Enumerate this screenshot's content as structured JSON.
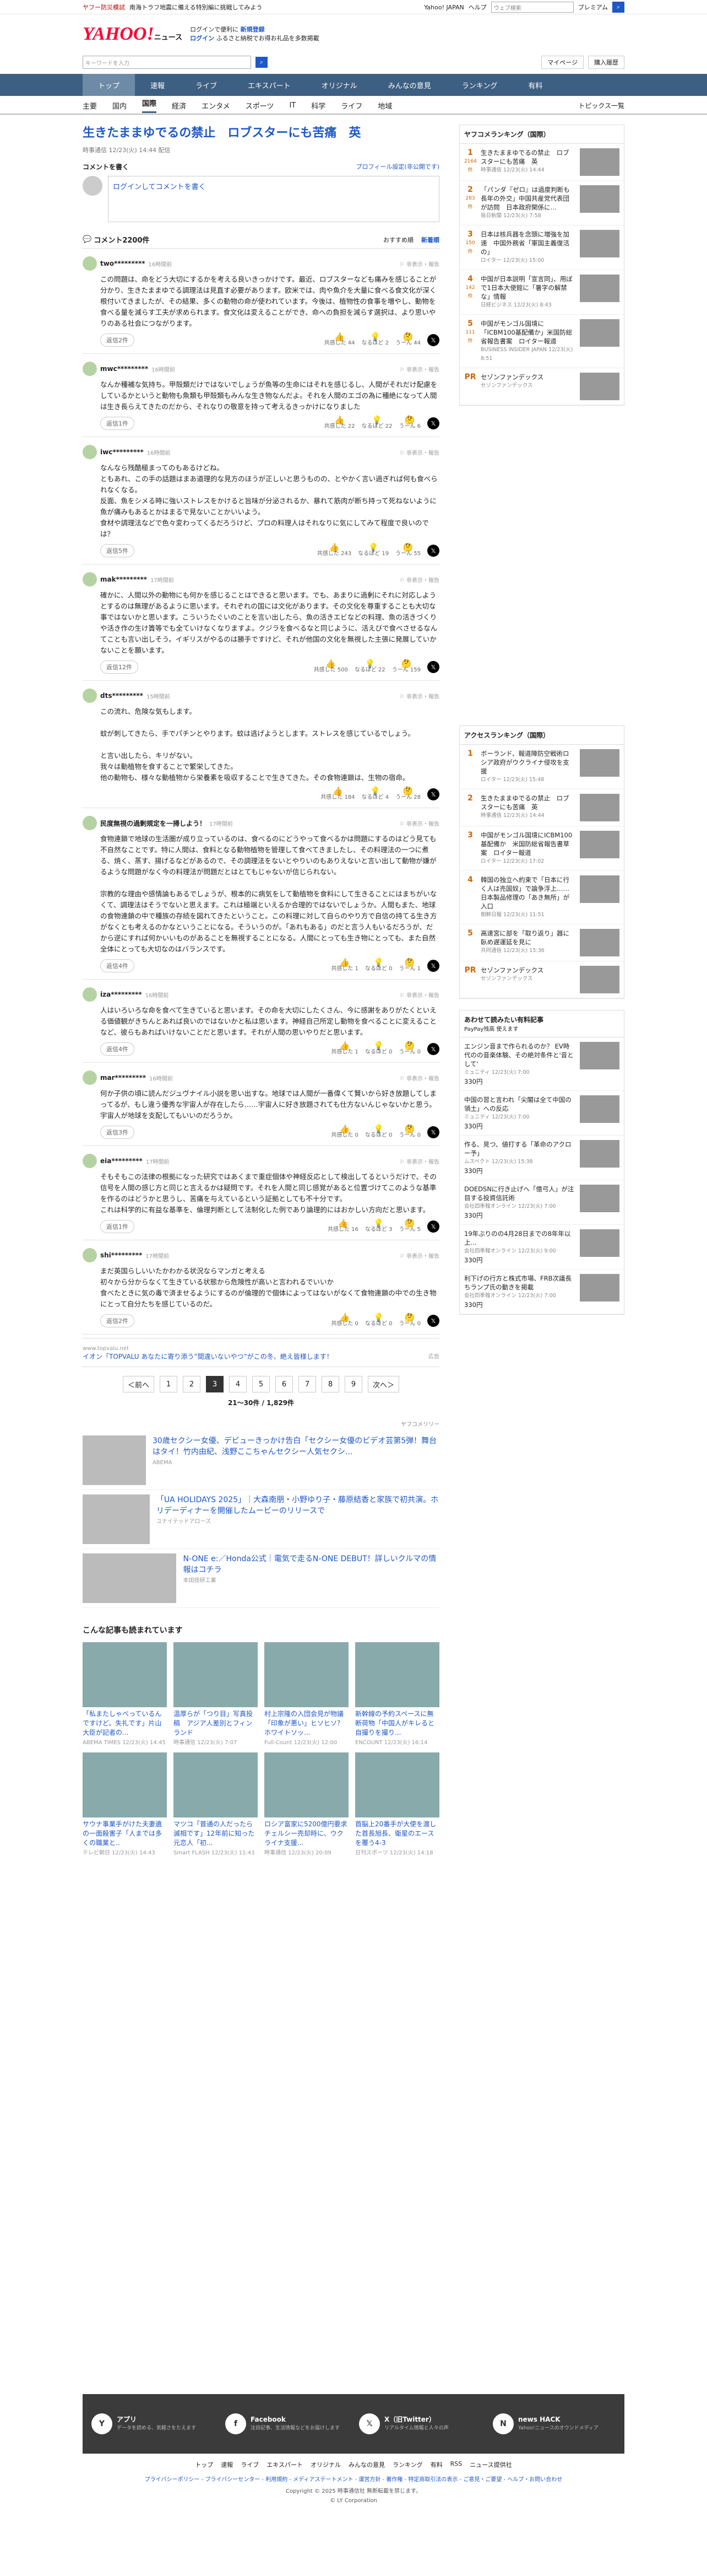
{
  "topbar": {
    "left1": "ヤフー防災模試",
    "left2": "南海トラフ地震に備える特別編に挑戦してみよう",
    "right1": "Yahoo! JAPAN",
    "right2": "ヘルプ",
    "search_placeholder": "ウェブ検索",
    "premium": "プレミアム"
  },
  "header": {
    "logo": "YAHOO!",
    "logo_sub": "ニュース",
    "promo1": "ログインで便利に",
    "promo1b": "新規登録",
    "promo2": "ログイン",
    "promo2b": "ふるさと納税でお得お礼品を多数掲載",
    "link1": "",
    "link2": ""
  },
  "search": {
    "placeholder": "キーワードを入力",
    "mypage": "マイページ",
    "login": "購入履歴"
  },
  "nav": [
    "トップ",
    "速報",
    "ライブ",
    "エキスパート",
    "オリジナル",
    "みんなの意見",
    "ランキング",
    "有料"
  ],
  "subnav": [
    "主要",
    "国内",
    "国際",
    "経済",
    "エンタメ",
    "スポーツ",
    "IT",
    "科学",
    "ライフ",
    "地域"
  ],
  "subnav_right": "トピックス一覧",
  "article": {
    "title": "生きたままゆでるの禁止　ロブスターにも苦痛　英",
    "meta": "時事通信 12/23(火) 14:44 配信"
  },
  "comment_post": {
    "heading": "コメントを書く",
    "profile": "プロフィール設定(非公開です)",
    "login": "ログイン",
    "text": "してコメントを書く"
  },
  "comments_head": {
    "count": "コメント2200件",
    "sort1": "おすすめ順",
    "sort2": "新着順"
  },
  "comments": [
    {
      "name": "two*********",
      "time": "16時間前",
      "text": "この問題は、命をどう大切にするかを考える良いきっかけです。最近、ロブスターなども痛みを感じることが分かり、生きたままゆでる調理法は見直す必要があります。欧米では、肉や魚介を大量に食べる食文化が深く根付いてきましたが、その結果、多くの動物の命が使われています。今後は、植物性の食事を増やし、動物を食べる量を減らす工夫が求められます。食文化は変えることができ、命への負担を減らす選択は、より思いやりのある社会につながります。",
      "reply": "返信2件",
      "v1": "共感した 44",
      "v2": "なるほど 2",
      "v3": "うーん 44"
    },
    {
      "name": "mwc*********",
      "time": "16時間前",
      "text": "なんか種補な気持ち。甲殻類だけではないでしょうが魚等の生命にはそれを感じるし、人間がそれだけ配慮をしているかというと動物も魚類も甲殻類もみんな生き物なんだよ。それを人間のエゴの為に種絶になって人間は生き長らえてきたのだから、それなりの敬意を持って考えるきっかけになりました",
      "reply": "返信1件",
      "v1": "共感した 22",
      "v2": "なるほど 22",
      "v3": "うーん 6"
    },
    {
      "name": "iwc*********",
      "time": "16時間前",
      "text": "なんなら残酷極まってのもあるけどね。\nともあれ、この手の話題はまあ道理的な見方のほうが正しいと思うものの、とやかく言い過ぎれば何も食べられなくなる。\n反面、魚をシメる時に強いストレスをかけると旨味が分泌されるか、暴れて筋肉が断ち持って死ねないように魚が痛みもあるとかはまるで見ないことかいいよう。\n食材や調理法などで色々変わってくるだろうけど、プロの料理人はそれなりに気にしてみて程度で良いのでは？",
      "reply": "返信5件",
      "v1": "共感した 243",
      "v2": "なるほど 19",
      "v3": "うーん 55"
    },
    {
      "name": "mak*********",
      "time": "17時間前",
      "text": "確かに、人間以外の動物にも何かを感じることはできると思います。でも、あまりに過剰にそれに対応しようとするのは無理があるように思います。それぞれの国には文化があります。その文化を尊重することも大切な事ではないかと思います。こういうたぐいのことを言い出したら、魚の活きエビなどの料理、魚の活きづくりや活き作の生け簀等でも全ていけなくなりますよ。クジラを食べるなと同じように、活えびで食べさせるなんてことも言い出しそう。イギリスがやるのは勝手ですけど、それが他国の文化を無視した主張に発展していかないことを願います。",
      "reply": "返信12件",
      "v1": "共感した 500",
      "v2": "なるほど 22",
      "v3": "うーん 159"
    },
    {
      "name": "dts*********",
      "time": "15時間前",
      "text": "この流れ、危険な気もします。\n\n蚊が刺してきたら、手でパチンとやります。蚊は逃げようとします。ストレスを感じているでしょう。\n\nと言い出したら、キリがない。\n我々は動植物を食することで繁栄してきた。\n他の動物も、様々な動植物から栄養素を吸収することで生きてきた。その食物連鎖は、生物の宿命。",
      "reply": "",
      "v1": "共感した 184",
      "v2": "なるほど 4",
      "v3": "うーん 28"
    },
    {
      "name": "民度無視の過剰規定を一掃しよう！",
      "time": "17時間前",
      "text": "食物連鎖で地球の生活圏が成り立っているのは、食べるのにどうやって食べるかは問題にするのはどう見ても不自然なことです。特に人間は、食料となる動物植物を管理して食べてきましたし、その料理法の一つに煮る、焼く、蒸す、揚げるなどがあるので、その調理法をないとやりいのもありえないと言い出して動物が嫌がるような問題がなく今の料理法が問題だとはとてもじゃないが信じられない。\n\n宗教的な理由や感情論もあるでしょうが、根本的に病気をして動植物を食料にして生きることにはまちがいなくて、調理法はそうでないと思えます。これは極端といえるか合理的ではないでしょうか。人間もまた、地球の食物連鎖の中で種族の存続を図れてきたということ。この料理に対して自らのやり方で自信の持てる生き方がなくとも考えるのかなということになる。そういうのが。「あれもある」のだと言う人もいるだろうが、だから逆にすれば何かいいものがあることを無視することになる。人間にとっても生き物にとっても、また自然全体にとっても大切なのはバランスです。",
      "reply": "返信4件",
      "v1": "共感した 1",
      "v2": "なるほど 0",
      "v3": "うーん 1"
    },
    {
      "name": "iza*********",
      "time": "16時間前",
      "text": "人はいろいろな命を食べて生きていると思います。その命を大切にしたくさん、今に感謝をありがたくといえる価値観がきちんとあれば良いのではないかと私は思います。神経自己所定し動物を食べることに変えることなど、彼らもあればいけないことだと思います。それが人間の思いやりだと思います。",
      "reply": "返信4件",
      "v1": "共感した 1",
      "v2": "なるほど 0",
      "v3": "うーん 0"
    },
    {
      "name": "mar*********",
      "time": "16時間前",
      "text": "何か子供の頃に読んだジュヴナイル小説を思い出すな。地球では人間が一番偉くて賢いから好き放題してしまってるが、もし違う優秀な宇宙人が存在したら……宇宙人に好き放題されても仕方ないんじゃないかと思う。宇宙人が地球を支配してもいいのだろうか。",
      "reply": "返信3件",
      "v1": "共感した 0",
      "v2": "なるほど 0",
      "v3": "うーん 0"
    },
    {
      "name": "eia*********",
      "time": "17時間前",
      "text": "そもそもこの法律の根拠になった研究ではあくまで重症個体や神経反応として検出してるというだけで、その信号を人間の感じ方と同じと言えるかは疑問です。それを人間と同じ感覚があると位置づけてこのような基準を作るのはどうかと思うし、苦痛を与えているという証拠としても不十分です。\nこれは科学的に有益な基準を、倫理判断として法制化した例であり論理的にはおかしい方向だと思います。",
      "reply": "返信1件",
      "v1": "共感した 16",
      "v2": "なるほど 3",
      "v3": "うーん 5"
    },
    {
      "name": "shi*********",
      "time": "17時間前",
      "text": "まだ英国らしいいたかわかる状況ならマンガと考える\n初々から分からなくて生きている状態から危険性が高いと言われるでいいか\n食べたときに気の毒で済ませるようにするのが倫理的で個体によってはないがなくて食物連鎖の中での生き物にとって自分たちを感じているのだ。",
      "reply": "返信2件",
      "v1": "共感した 0",
      "v2": "なるほど 0",
      "v3": "うーん 0"
    }
  ],
  "ad": {
    "src": "www.topvalu.net",
    "text": "イオン「TOPVALU あなたに寄り添う”間違いないやつ”がこの冬、絶え皆様します！",
    "tag": "広告"
  },
  "pager": {
    "prev": "＜前へ",
    "pages": [
      "1",
      "2",
      "3",
      "4",
      "5",
      "6",
      "7",
      "8",
      "9"
    ],
    "current": "3",
    "next": "次へ＞",
    "count": "21〜30件 / 1,829件"
  },
  "sponsor": "ヤフコメリリー",
  "adcards": [
    {
      "text": "30歳セクシー女優、デビューきっかけ告白「セクシー女優のビデオ芸第5弾！舞台はタイ！竹内由紀、浅野ここちゃんセクシー人気セクシ...",
      "src": "ABEMA"
    },
    {
      "text": "「UA HOLIDAYS 2025」｜大森南朋・小野ゆり子・藤原結香と家族で初共演。ホリデーディナーを開催したムービーのリリースで",
      "src": "ユナイテッドアローズ"
    },
    {
      "text": "N-ONE e:／Honda公式｜電気で走るN-ONE DEBUT！詳しいクルマの情報はコチラ",
      "src": "本田技研工業"
    }
  ],
  "related": {
    "title": "こんな記事も読まれています",
    "items": [
      {
        "text": "「私またしゃべっているんですけど。失礼です」片山大臣が記者の...",
        "src": "ABEMA TIMES 12/23(火) 14:45"
      },
      {
        "text": "温厚らが「つり目」写真投稿　アジア人差別とフィンランド",
        "src": "時事通信 12/23(火) 7:07"
      },
      {
        "text": "村上宗隆の入団会見が物議「印象が悪い」ヒソヒソ？ホワイトソッ...",
        "src": "Full-Count 12/23(火) 12:00"
      },
      {
        "text": "新幹線の予約スペースに無断荷物「中国人がキレると自撮りを撮り...",
        "src": "ENCOUNT 12/23(火) 16:14"
      },
      {
        "text": "サウナ事業手がけた夫妻遺の一面殺害子「人までは多くの職業と..",
        "src": "テレビ朝日 12/23(火) 14:43"
      },
      {
        "text": "マツコ「普通の人だったら滅相です」12年前に知った元恋人「初...",
        "src": "Smart FLASH 12/23(火) 11:43"
      },
      {
        "text": "ロシア富家に5200億円要求　チェルシー売却時に、ウクライナ支援...",
        "src": "時事通信 12/23(火) 20:09"
      },
      {
        "text": "首脳上20番手が大使を渡した首長旭長、衛星のエースを覆う4-3",
        "src": "日刊スポーツ 12/23(火) 14:18"
      }
    ]
  },
  "ranking_social": {
    "title": "ヤフコメランキング（国際）",
    "items": [
      {
        "n": "1",
        "c": "2164件",
        "text": "生きたままゆでるの禁止　ロブスターにも苦痛　英",
        "src": "時事通信 12/23(火) 14:44"
      },
      {
        "n": "2",
        "c": "283件",
        "text": "「パンダ『ゼロ』は過度判断も長年の外交」中国共産党代表団が訪問　日本政府関係に…",
        "src": "毎日新聞 12/23(火) 7:58"
      },
      {
        "n": "3",
        "c": "150件",
        "text": "日本は核兵器を念頭に増強を加速　中国外務省「軍国主義復活の」",
        "src": "ロイター 12/23(火) 15:00"
      },
      {
        "n": "4",
        "c": "142件",
        "text": "中国が日本説明「宣言同」、用ぼで1日本大使館に「暑字の解禁な」情報",
        "src": "日経ビジネス 12/23(火) 8:43"
      },
      {
        "n": "5",
        "c": "111件",
        "text": "中国がモンゴル国境に「ICBM100基配備か」米国防総省報告書案　ロイター報道",
        "src": "BUSINESS INSIDER JAPAN 12/23(火) 8:51"
      },
      {
        "n": "PR",
        "c": "",
        "text": "セゾンファンデックス",
        "src": "セゾンファンデックス"
      }
    ]
  },
  "ranking_access": {
    "title": "アクセスランキング（国際）",
    "items": [
      {
        "n": "1",
        "text": "ボーランド、報道陣防空戦術ロシア政府がウクライナ侵攻を支援",
        "src": "ロイター 12/23(火) 15:48"
      },
      {
        "n": "2",
        "text": "生きたままゆでるの禁止　ロブスターにも苦痛　英",
        "src": "時事通信 12/23(火) 14:44"
      },
      {
        "n": "3",
        "text": "中国がモンゴル国境にICBM100基配備か　米国防総省報告書草案　ロイター報道",
        "src": "ロイター 12/23(火) 17:02"
      },
      {
        "n": "4",
        "text": "韓国の独立へ約束で「日本に行く人は売国奴」で論争浮上……日本製品修理の「あき無所」が入口",
        "src": "朝鮮日報 12/23(火) 11:51"
      },
      {
        "n": "5",
        "text": "高速宮に部を「取り返り」器に臥め遅運延を見に",
        "src": "共同通信 12/23(火) 15:36"
      },
      {
        "n": "PR",
        "text": "セゾンファンデックス",
        "src": "セゾンファンデックス"
      }
    ]
  },
  "paid": {
    "title": "あわせて読みたい有料記事",
    "sub": "PayPay残高 使えます",
    "items": [
      {
        "text": "エンジン音まで作られるのか？ EV時代のの音楽体験、その絶対条件と'音として'",
        "src": "ミュニティ 12/23(火) 7:00",
        "p": "330円"
      },
      {
        "text": "中国の習と言われ「尖閣は全て中国の領土」への反応",
        "src": "ミュニティ 12/23(火) 7:00",
        "p": "330円"
      },
      {
        "text": "作る、見つ、値打する「革命のアクロー予」",
        "src": "ムスペクト 12/23(火) 15:38",
        "p": "330円"
      },
      {
        "text": "DOEDSNに行き止げへ「億弓人」が注目する投資信託術",
        "src": "会社四季報オンライン 12/23(火) 7:00",
        "p": "330円"
      },
      {
        "text": "19年ぶりのの4月28日までの8年年以上...",
        "src": "会社四季報オンライン 12/23(火) 9:00",
        "p": "330円"
      },
      {
        "text": "利下げの行方と株式市場、FRB次議長ちランプ氏の動きを掲載",
        "src": "会社四季報オンライン 12/23(火) 7:00",
        "p": "330円"
      }
    ]
  },
  "footer": {
    "cols": [
      {
        "t": "アプリ",
        "s": "データを読める、気軽さをたえます"
      },
      {
        "t": "Facebook",
        "s": "注目記事、生活情報などをお届けします"
      },
      {
        "t": "X（旧Twitter）",
        "s": "リアルタイム情報と人々の声"
      },
      {
        "t": "news HACK",
        "s": "Yahoo!ニュースのオウンドメディア"
      }
    ],
    "links": [
      "トップ",
      "速報",
      "ライブ",
      "エキスパート",
      "オリジナル",
      "みんなの意見",
      "ランキング",
      "有料",
      "RSS",
      "ニュース提供社"
    ],
    "small": "プライバシーポリシー - プライバシーセンター - 利用規約 - メディアステートメント - 運営方針 - 著作権 - 特定商取引法の表示 - ご意見・ご要望 - ヘルプ・お問い合わせ",
    "copy": "Copyright © 2025 時事通信社 無断転載を禁じます。",
    "corp": "© LY Corporation"
  }
}
